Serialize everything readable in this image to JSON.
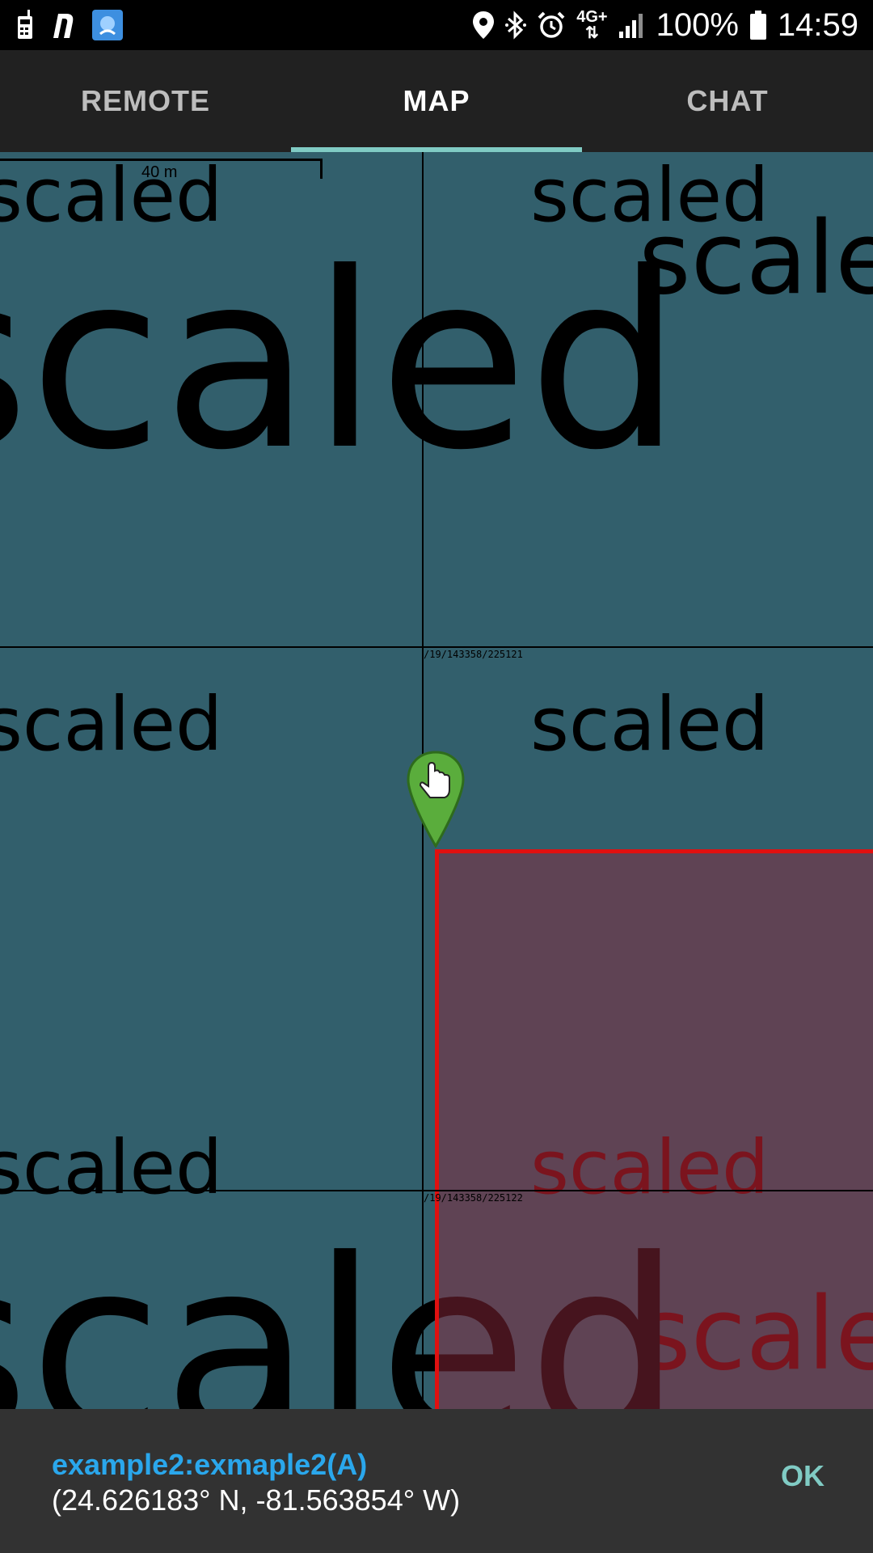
{
  "status_bar": {
    "battery_percent": "100%",
    "time": "14:59",
    "network_type": "4G+",
    "icons": [
      "walkie-talkie-icon",
      "n-app-icon",
      "app-thumbnail-icon",
      "location-icon",
      "bluetooth-icon",
      "alarm-icon",
      "network-arrows-icon",
      "signal-icon",
      "battery-icon"
    ]
  },
  "tabs": [
    {
      "label": "REMOTE",
      "active": false
    },
    {
      "label": "MAP",
      "active": true
    },
    {
      "label": "CHAT",
      "active": false
    }
  ],
  "map": {
    "scale_label": "40 m",
    "tile_word": "scaled",
    "tile_ids": [
      "/19/143358/225121",
      "/19/143358/225122"
    ],
    "marker_icon": "pointing-hand-marker-icon",
    "polygon_color": "#e01010",
    "background_color": "#325f6c"
  },
  "fab": {
    "icon": "map-icon"
  },
  "bottom_bar": {
    "title": "example2:exmaple2(A)",
    "coordinates": "(24.626183° N, -81.563854° W)",
    "ok_label": "OK"
  }
}
